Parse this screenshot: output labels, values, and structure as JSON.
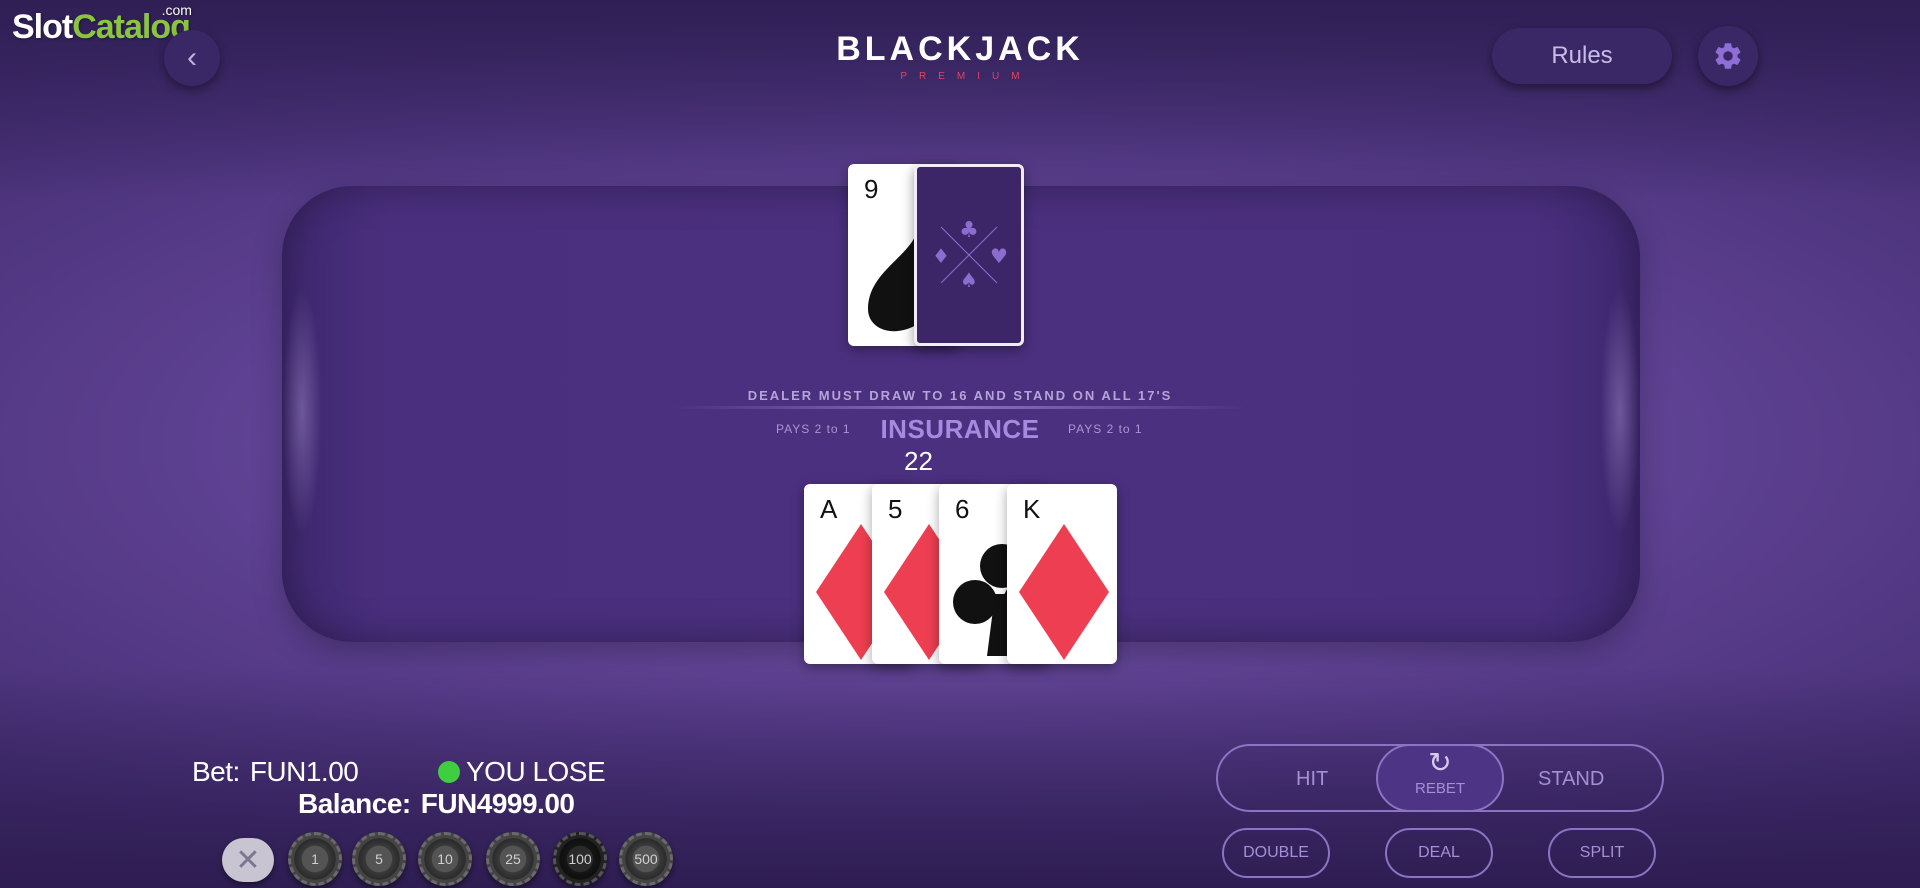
{
  "watermark": {
    "part1": "Slot",
    "part2": "Catalog",
    "part3": ".com"
  },
  "header": {
    "back_icon": "chevron-left-icon",
    "back_glyph": "‹",
    "logo_title": "BLACKJACK",
    "logo_subtitle": "PREMIUM",
    "rules_label": "Rules",
    "settings_icon": "gear-icon"
  },
  "table": {
    "rule_text": "DEALER MUST DRAW TO 16 AND STAND ON ALL 17'S",
    "pays_left": "PAYS 2  to 1",
    "insurance_label": "INSURANCE",
    "pays_right": "PAYS 2  to 1",
    "player_score": "22"
  },
  "dealer_hand": [
    {
      "rank": "9",
      "suit": "spade",
      "color": "#111111",
      "face_up": true
    },
    {
      "rank": "",
      "suit": "back",
      "face_up": false
    }
  ],
  "player_hand": [
    {
      "rank": "A",
      "suit": "diamond",
      "color": "#ee3e52"
    },
    {
      "rank": "5",
      "suit": "diamond",
      "color": "#ee3e52"
    },
    {
      "rank": "6",
      "suit": "club",
      "color": "#111111"
    },
    {
      "rank": "K",
      "suit": "diamond",
      "color": "#ee3e52"
    }
  ],
  "status": {
    "bet_label": "Bet:",
    "bet_value": "FUN1.00",
    "result_text": "YOU LOSE",
    "result_color": "#3fce3f",
    "balance_label": "Balance:",
    "balance_value": "FUN4999.00"
  },
  "chips": {
    "clear_glyph": "✕",
    "values": [
      "1",
      "5",
      "10",
      "25",
      "100",
      "500"
    ]
  },
  "actions": {
    "hit": "HIT",
    "rebet": "REBET",
    "rebet_glyph": "↻",
    "stand": "STAND",
    "double": "DOUBLE",
    "deal": "DEAL",
    "split": "SPLIT"
  },
  "colors": {
    "background": "#5b3f8f",
    "table_felt": "#4b307f",
    "accent": "#a58be0",
    "card_red": "#ee3e52",
    "card_back": "#3c2668"
  }
}
